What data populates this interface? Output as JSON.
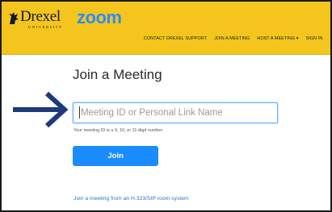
{
  "header": {
    "brand": {
      "university": "Drexel",
      "university_sub": "UNIVERSITY",
      "product": "zoom"
    },
    "nav": [
      {
        "label": "CONTACT DREXEL SUPPORT"
      },
      {
        "label": "JOIN A MEETING"
      },
      {
        "label": "HOST A MEETING ▾"
      },
      {
        "label": "SIGN IN"
      }
    ]
  },
  "main": {
    "title": "Join a Meeting",
    "meeting_input": {
      "value": "",
      "placeholder": "Meeting ID or Personal Link Name"
    },
    "hint": "Your meeting ID is a 9, 10, or 11-digit number",
    "join_label": "Join",
    "sip_link": "Join a meeting from an H.323/SIP room system"
  },
  "colors": {
    "header_bg": "#f4c51d",
    "zoom_blue": "#2d8cff",
    "join_button": "#1a8cff",
    "arrow": "#1f3a7a",
    "link": "#2d6fd8"
  },
  "icons": {
    "pointer_arrow": "arrow-right-icon",
    "drexel_mark": "dragon-icon"
  }
}
